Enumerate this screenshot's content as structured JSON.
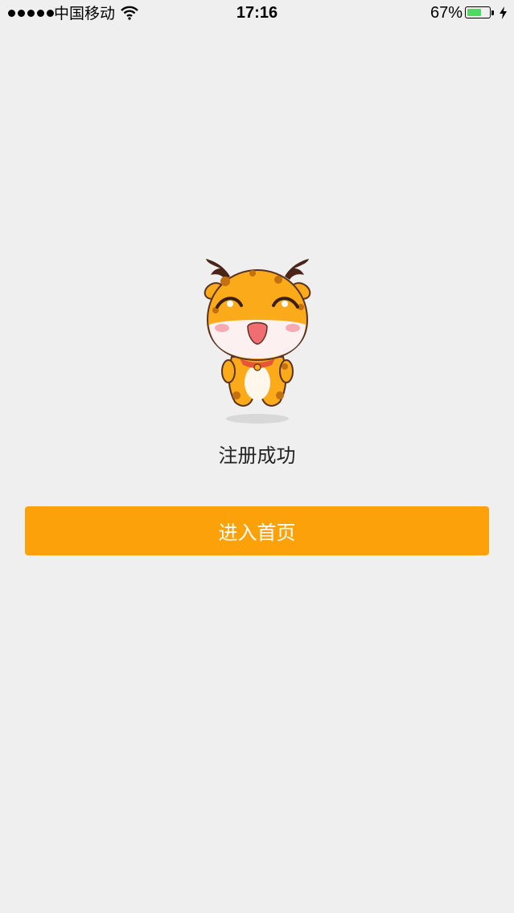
{
  "status_bar": {
    "carrier": "中国移动",
    "time": "17:16",
    "battery_percent_text": "67%",
    "battery_level": 0.67,
    "battery_color": "#4cd964"
  },
  "main": {
    "mascot_icon": "giraffe-mascot-icon",
    "success_message": "注册成功",
    "enter_button_label": "进入首页",
    "accent_color": "#fda10a"
  }
}
